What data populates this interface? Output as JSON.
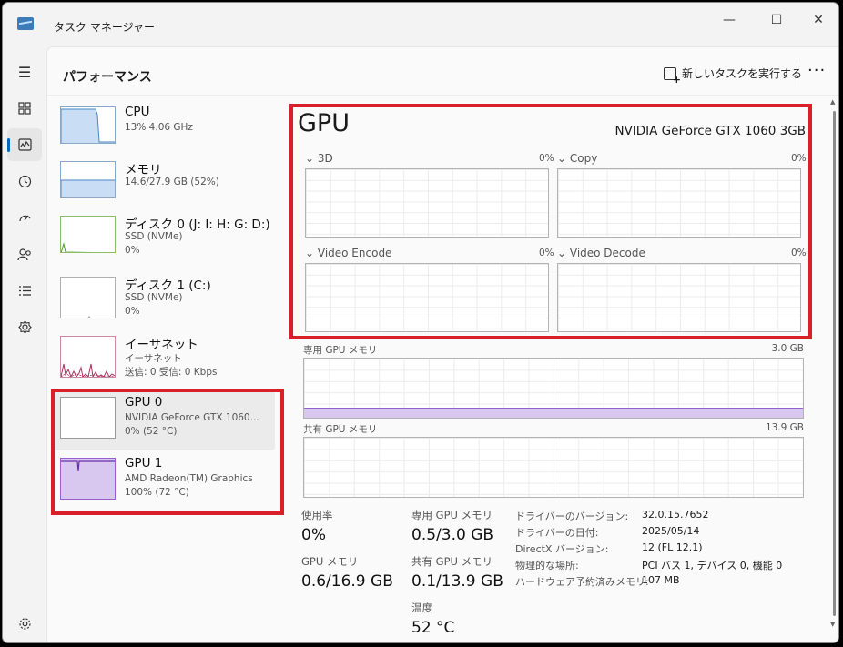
{
  "window": {
    "title": "タスク マネージャー",
    "minimize": "—",
    "maximize": "☐",
    "close": "✕"
  },
  "header": {
    "page_title": "パフォーマンス",
    "new_task_label": "新しいタスクを実行する",
    "more_label": "···"
  },
  "nav": {
    "hamburger": "☰",
    "items": [
      "processes-icon",
      "performance-icon",
      "app-history-icon",
      "startup-icon",
      "users-icon",
      "details-icon",
      "services-icon"
    ],
    "settings": "settings-icon"
  },
  "devices": [
    {
      "name": "CPU",
      "sub1": "13%  4.06 GHz",
      "sub2": ""
    },
    {
      "name": "メモリ",
      "sub1": "14.6/27.9 GB (52%)",
      "sub2": ""
    },
    {
      "name": "ディスク 0 (J: I: H: G: D:)",
      "sub1": "SSD (NVMe)",
      "sub2": "0%"
    },
    {
      "name": "ディスク 1 (C:)",
      "sub1": "SSD (NVMe)",
      "sub2": "0%"
    },
    {
      "name": "イーサネット",
      "sub1": "イーサネット",
      "sub2": "送信: 0 受信: 0 Kbps"
    },
    {
      "name": "GPU 0",
      "sub1": "NVIDIA GeForce GTX 1060...",
      "sub2": "0%  (52 °C)"
    },
    {
      "name": "GPU 1",
      "sub1": "AMD Radeon(TM) Graphics",
      "sub2": "100%  (72 °C)"
    }
  ],
  "detail": {
    "title": "GPU",
    "model": "NVIDIA GeForce GTX 1060 3GB",
    "engines": [
      {
        "label": "3D",
        "pct": "0%"
      },
      {
        "label": "Copy",
        "pct": "0%"
      },
      {
        "label": "Video Encode",
        "pct": "0%"
      },
      {
        "label": "Video Decode",
        "pct": "0%"
      }
    ],
    "dedicated_mem_label": "専用 GPU メモリ",
    "dedicated_mem_max": "3.0 GB",
    "dedicated_mem_fraction": 0.17,
    "shared_mem_label": "共有 GPU メモリ",
    "shared_mem_max": "13.9 GB",
    "stats": {
      "usage_label": "使用率",
      "usage_value": "0%",
      "gpu_mem_label": "GPU メモリ",
      "gpu_mem_value": "0.6/16.9 GB",
      "ded_label": "専用 GPU メモリ",
      "ded_value": "0.5/3.0 GB",
      "shared_label": "共有 GPU メモリ",
      "shared_value": "0.1/13.9 GB",
      "temp_label": "温度",
      "temp_value": "52 °C"
    },
    "info": [
      {
        "k": "ドライバーのバージョン:",
        "v": "32.0.15.7652"
      },
      {
        "k": "ドライバーの日付:",
        "v": "2025/05/14"
      },
      {
        "k": "DirectX バージョン:",
        "v": "12 (FL 12.1)"
      },
      {
        "k": "物理的な場所:",
        "v": "PCI バス 1, デバイス 0, 機能 0"
      },
      {
        "k": "ハードウェア予約済みメモリ:",
        "v": "107 MB"
      }
    ]
  },
  "colors": {
    "accent": "#0067c0",
    "highlight_red": "#d9202a",
    "gpu_fill": "#d8c8f0",
    "gpu_line": "#9a5fcf",
    "mem_fill": "#c9ddf5",
    "net_line": "#a8325a"
  }
}
